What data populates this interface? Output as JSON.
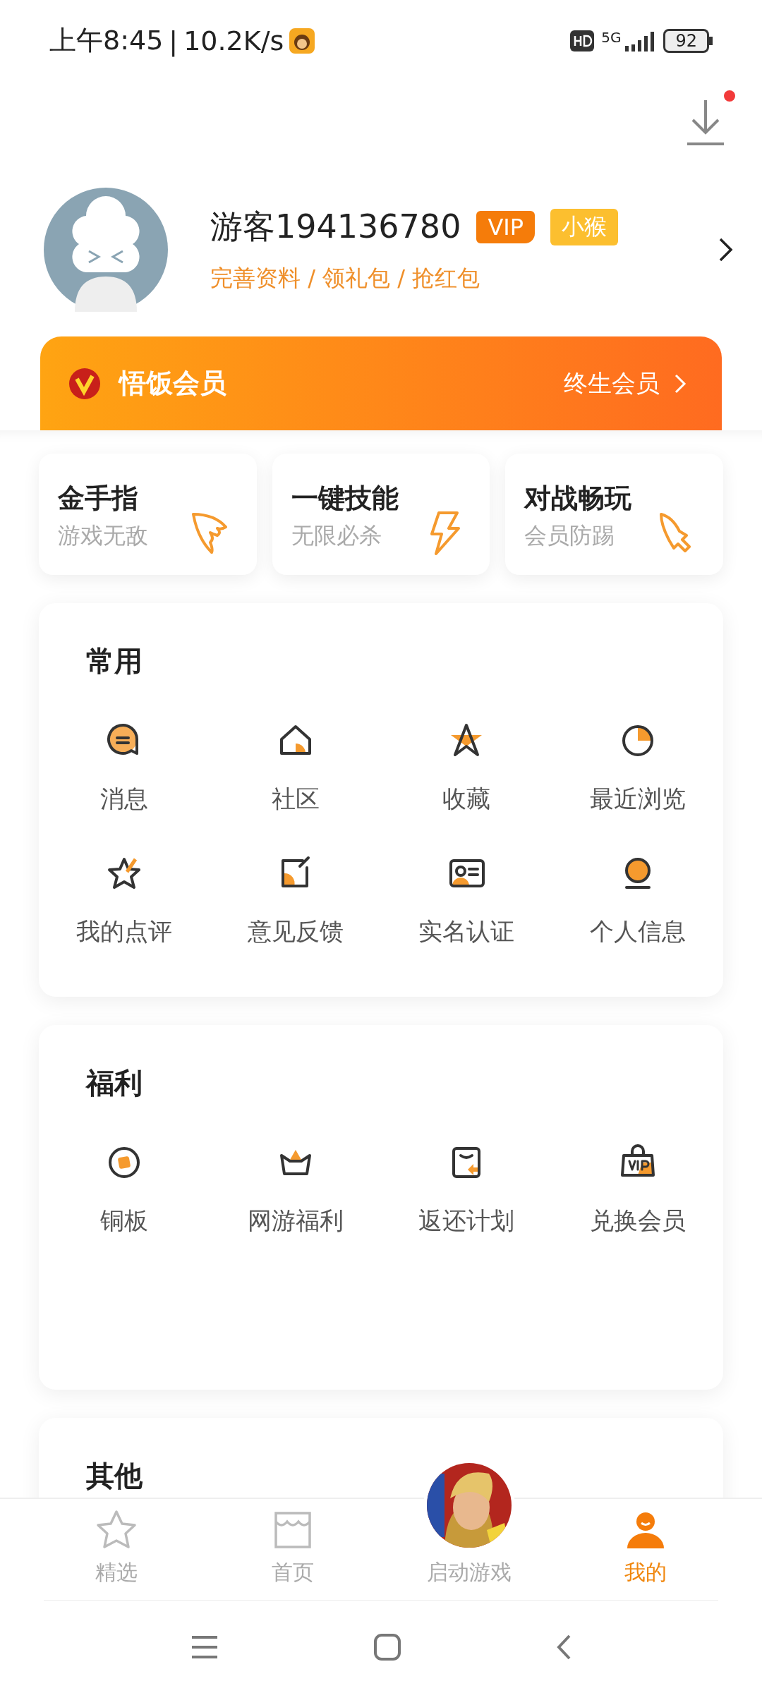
{
  "status_bar": {
    "time": "上午8:45",
    "separator": "|",
    "speed": "10.2K/s",
    "network": "5G",
    "battery": "92"
  },
  "header": {
    "download_has_update": true
  },
  "profile": {
    "name": "游客194136780",
    "badges": [
      {
        "text": "VIP",
        "color": "#f57c0a"
      },
      {
        "text": "小猴",
        "color": "#fcbf2f"
      }
    ],
    "links": "完善资料 / 领礼包 / 抢红包"
  },
  "vip_banner": {
    "title": "悟饭会员",
    "action": "终生会员"
  },
  "features": [
    {
      "title": "金手指",
      "subtitle": "游戏无敌"
    },
    {
      "title": "一键技能",
      "subtitle": "无限必杀"
    },
    {
      "title": "对战畅玩",
      "subtitle": "会员防踢"
    }
  ],
  "sections": [
    {
      "title": "常用",
      "items": [
        "消息",
        "社区",
        "收藏",
        "最近浏览",
        "我的点评",
        "意见反馈",
        "实名认证",
        "个人信息"
      ]
    },
    {
      "title": "福利",
      "items": [
        "铜板",
        "网游福利",
        "返还计划",
        "兑换会员"
      ]
    },
    {
      "title": "其他"
    }
  ],
  "bottom_nav": [
    {
      "label": "精选",
      "kind": "star",
      "selected": false
    },
    {
      "label": "首页",
      "kind": "store",
      "selected": false
    },
    {
      "label": "启动游戏",
      "kind": "game",
      "selected": false
    },
    {
      "label": "我的",
      "kind": "person",
      "selected": true
    }
  ]
}
